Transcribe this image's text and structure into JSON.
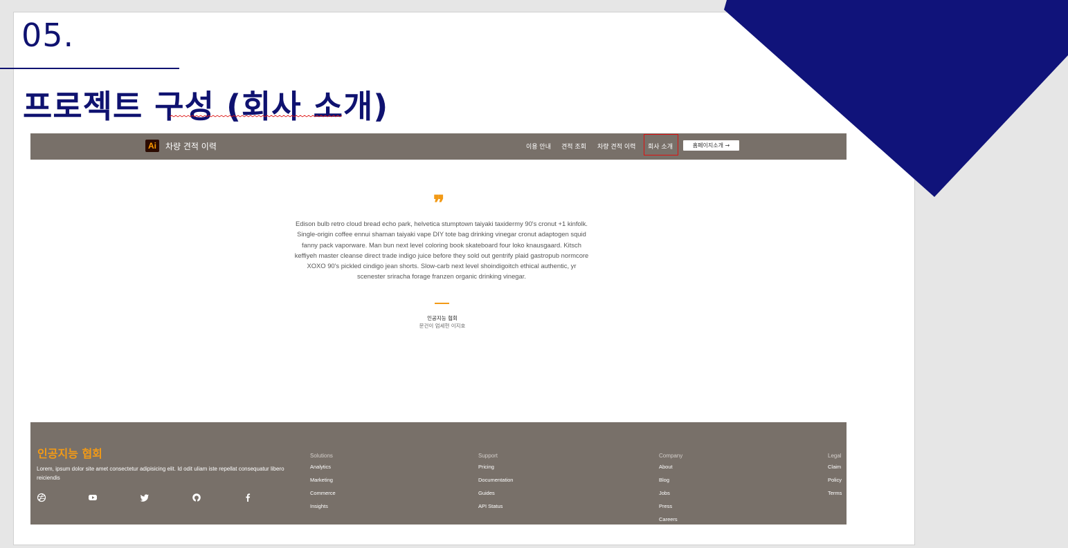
{
  "slide": {
    "number": "05.",
    "title": "프로젝트 구성 (회사 소개)",
    "colors": {
      "accent": "#0f1270",
      "corner": "#10137a"
    }
  },
  "site": {
    "brand": {
      "logo_text": "Ai",
      "name": "차량 견적 이력"
    },
    "nav": {
      "items": [
        "이용 안내",
        "견적 조회",
        "차량 견적 이력",
        "회사 소개"
      ],
      "active": "회사 소개",
      "cta": "홈페이지소개 →"
    },
    "testimonial": {
      "quote_mark": "❞",
      "text": "Edison bulb retro cloud bread echo park, helvetica stumptown taiyaki taxidermy 90's cronut +1 kinfolk. Single-origin coffee ennui shaman taiyaki vape DIY tote bag drinking vinegar cronut adaptogen squid fanny pack vaporware. Man bun next level coloring book skateboard four loko knausgaard. Kitsch keffiyeh master cleanse direct trade indigo juice before they sold out gentrify plaid gastropub normcore XOXO 90's pickled cindigo jean shorts. Slow-carb next level shoindigoitch ethical authentic, yr scenester sriracha forage franzen organic drinking vinegar.",
      "author": "인공지능 협회",
      "members": "문건이 엄세현 이지호"
    },
    "footer": {
      "brand": "인공지능 협회",
      "description": "Lorem, ipsum dolor site amet consectetur adipisicing elit. Id odit uliam iste repellat consequatur libero reiciendis",
      "social": [
        "dribbble-icon",
        "youtube-icon",
        "twitter-icon",
        "github-icon",
        "facebook-icon"
      ],
      "columns": [
        {
          "title": "Solutions",
          "links": [
            "Analytics",
            "Marketing",
            "Commerce",
            "Insights"
          ]
        },
        {
          "title": "Support",
          "links": [
            "Pricing",
            "Documentation",
            "Guides",
            "API Status"
          ]
        },
        {
          "title": "Company",
          "links": [
            "About",
            "Blog",
            "Jobs",
            "Press",
            "Careers"
          ]
        },
        {
          "title": "Legal",
          "links": [
            "Claim",
            "Policy",
            "Terms"
          ]
        }
      ]
    }
  }
}
